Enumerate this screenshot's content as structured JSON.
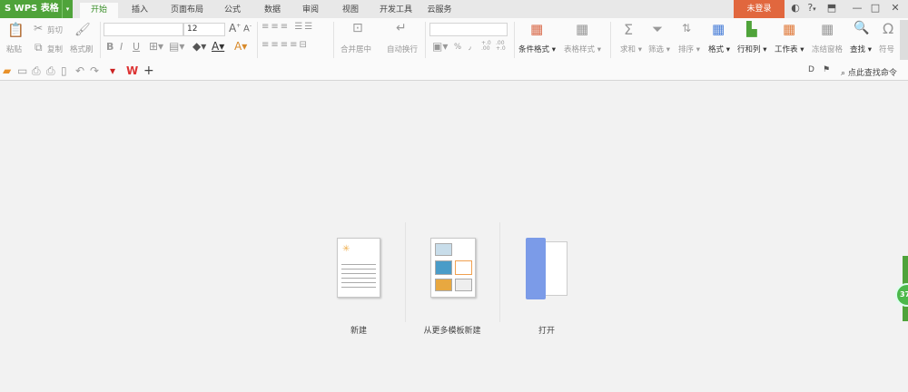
{
  "app": {
    "logo": "S WPS 表格",
    "logo_dropdown": "▾"
  },
  "tabs": [
    {
      "label": "开始",
      "active": true
    },
    {
      "label": "插入"
    },
    {
      "label": "页面布局"
    },
    {
      "label": "公式"
    },
    {
      "label": "数据"
    },
    {
      "label": "审阅"
    },
    {
      "label": "视图"
    },
    {
      "label": "开发工具"
    },
    {
      "label": "云服务"
    }
  ],
  "titlebar": {
    "login": "未登录",
    "help": "?",
    "help_dd": "▾"
  },
  "ribbon": {
    "paste": "粘贴",
    "cut": "剪切",
    "copy": "复制",
    "format_painter": "格式刷",
    "font_name": "",
    "font_size": "12",
    "bold": "B",
    "italic": "I",
    "underline": "U",
    "merge_center": "合并居中",
    "wrap_text": "自动换行",
    "number_format": "",
    "percent": "%",
    "comma": "٫",
    "inc_decimal": "+.0 .00",
    "dec_decimal": ".00 +.0",
    "conditional_format": "条件格式",
    "table_style": "表格样式",
    "sum": "求和",
    "filter": "筛选",
    "sort": "排序",
    "format": "格式",
    "rows_cols": "行和列",
    "worksheet": "工作表",
    "freeze": "冻结窗格",
    "find": "查找",
    "symbol": "符号"
  },
  "quickbar": {
    "search_command": "点此查找命令"
  },
  "start": {
    "new": "新建",
    "new_from_template": "从更多模板新建",
    "open": "打开"
  },
  "side_badge": "37",
  "colors": {
    "brand_green": "#4fa33a",
    "login_orange": "#e1673e",
    "folder_blue": "#7b9be8"
  }
}
